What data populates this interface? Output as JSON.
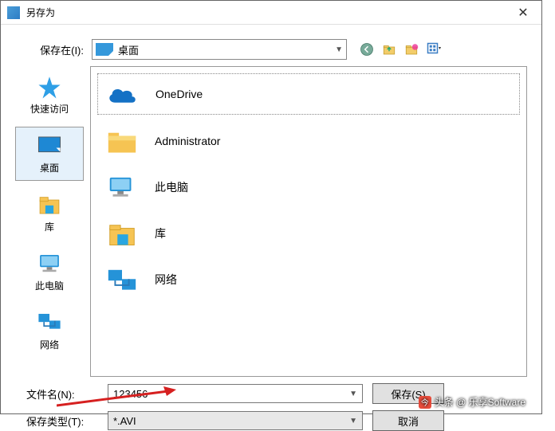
{
  "titlebar": {
    "title": "另存为"
  },
  "savein": {
    "label": "保存在(I):",
    "location": "桌面"
  },
  "sidebar": {
    "items": [
      {
        "label": "快速访问"
      },
      {
        "label": "桌面"
      },
      {
        "label": "库"
      },
      {
        "label": "此电脑"
      },
      {
        "label": "网络"
      }
    ]
  },
  "filelist": {
    "items": [
      {
        "label": "OneDrive"
      },
      {
        "label": "Administrator"
      },
      {
        "label": "此电脑"
      },
      {
        "label": "库"
      },
      {
        "label": "网络"
      }
    ]
  },
  "filename": {
    "label": "文件名(N):",
    "value": "123456"
  },
  "filetype": {
    "label": "保存类型(T):",
    "value": "*.AVI"
  },
  "buttons": {
    "save": "保存(S)",
    "cancel": "取消"
  },
  "watermark": "头条 @ 乐享Software"
}
